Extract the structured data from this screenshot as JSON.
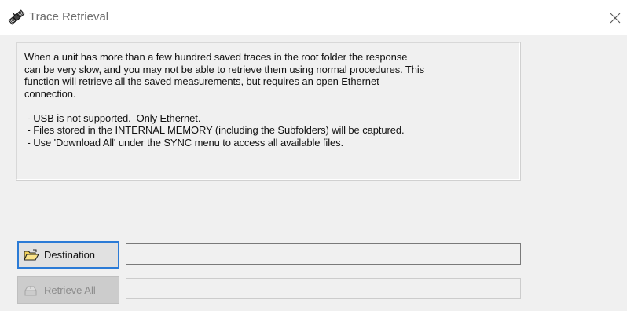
{
  "window": {
    "title": "Trace Retrieval",
    "app_icon": "satellite-icon",
    "close_icon": "close-icon"
  },
  "info": {
    "paragraph_lines": [
      "When a unit has more than a few hundred saved traces in the root folder the response",
      "can be very slow, and you may not be able to retrieve them using normal procedures. This",
      "function will retrieve all the saved measurements, but requires an open Ethernet",
      "connection."
    ],
    "bullets": [
      " - USB is not supported.  Only Ethernet.",
      " - Files stored in the INTERNAL MEMORY (including the Subfolders) will be captured.",
      " - Use 'Download All' under the SYNC menu to access all available files."
    ]
  },
  "destination": {
    "button_label": "Destination",
    "icon": "open-folder-icon",
    "path_value": ""
  },
  "retrieve": {
    "button_label": "Retrieve All",
    "icon": "retrieve-icon",
    "status_value": "",
    "enabled": false
  },
  "colors": {
    "background": "#f0f0f0",
    "titlebar": "#ffffff",
    "focus_border": "#2b7bd6",
    "disabled_text": "#8d8d8d"
  }
}
